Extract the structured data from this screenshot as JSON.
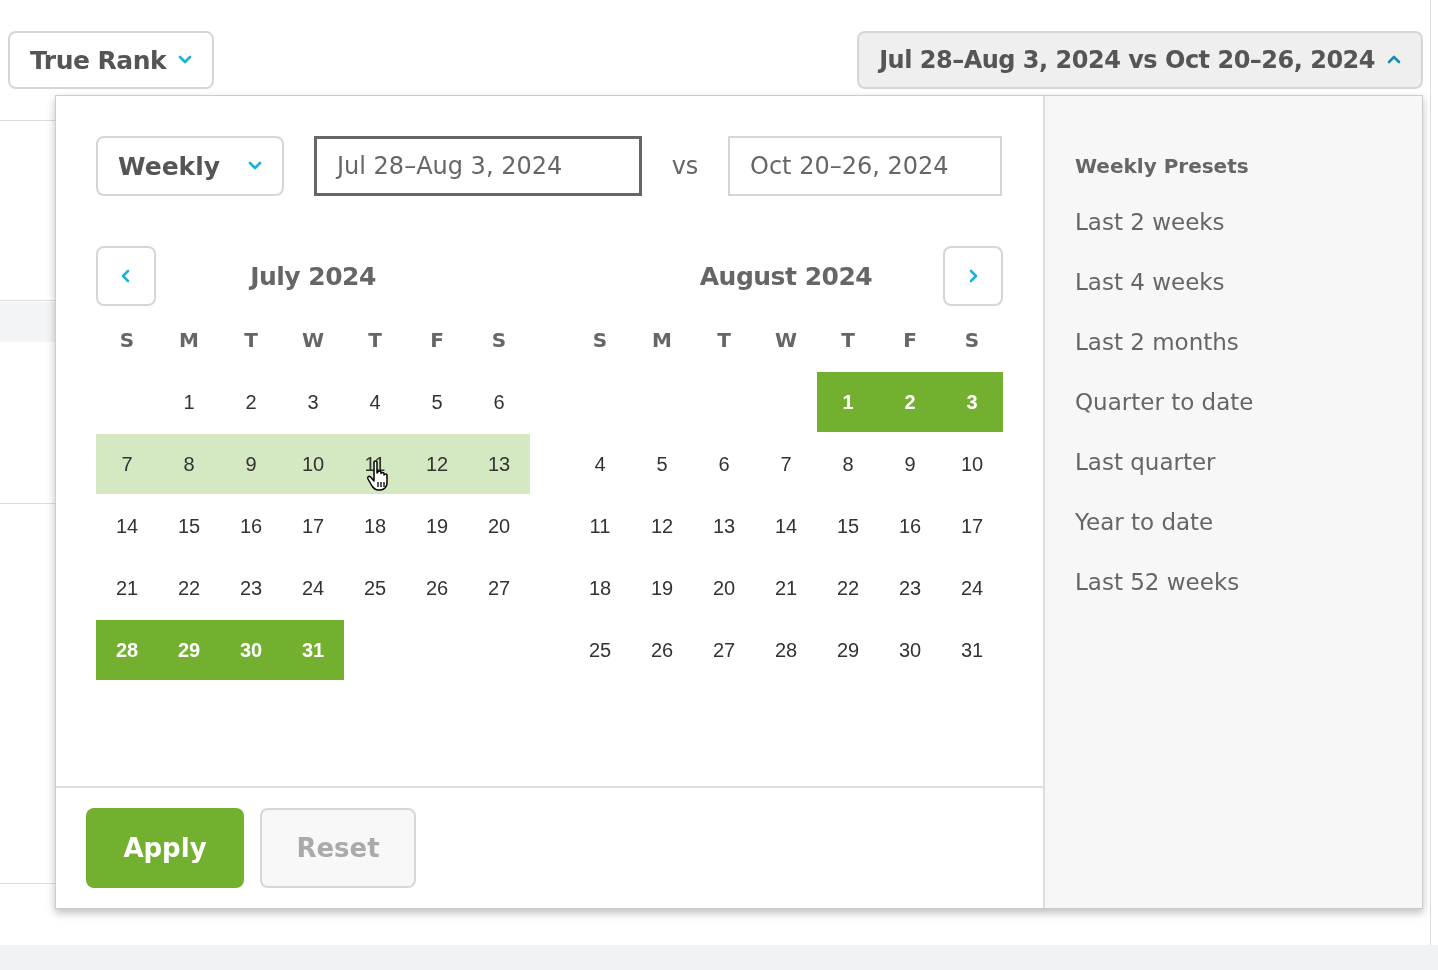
{
  "metric_button": {
    "label": "True Rank"
  },
  "range_button": {
    "label": "Jul 28–Aug 3, 2024 vs Oct 20–26, 2024",
    "expanded": true
  },
  "picker": {
    "period_select": {
      "label": "Weekly"
    },
    "primary_range": {
      "value": "Jul 28–Aug 3, 2024",
      "focused": true
    },
    "vs_label": "vs",
    "compare_range": {
      "value": "Oct 20–26, 2024",
      "focused": false
    },
    "months": [
      {
        "title": "July 2024",
        "weekdays": [
          "S",
          "M",
          "T",
          "W",
          "T",
          "F",
          "S"
        ],
        "weeks": [
          {
            "hovered": false,
            "days": [
              {
                "kind": "blank"
              },
              {
                "kind": "day",
                "label": "1",
                "selected": false
              },
              {
                "kind": "day",
                "label": "2",
                "selected": false
              },
              {
                "kind": "day",
                "label": "3",
                "selected": false
              },
              {
                "kind": "day",
                "label": "4",
                "selected": false
              },
              {
                "kind": "day",
                "label": "5",
                "selected": false
              },
              {
                "kind": "day",
                "label": "6",
                "selected": false
              }
            ]
          },
          {
            "hovered": true,
            "days": [
              {
                "kind": "day",
                "label": "7",
                "selected": false
              },
              {
                "kind": "day",
                "label": "8",
                "selected": false
              },
              {
                "kind": "day",
                "label": "9",
                "selected": false
              },
              {
                "kind": "day",
                "label": "10",
                "selected": false
              },
              {
                "kind": "day",
                "label": "11",
                "selected": false,
                "pointer": true
              },
              {
                "kind": "day",
                "label": "12",
                "selected": false
              },
              {
                "kind": "day",
                "label": "13",
                "selected": false
              }
            ]
          },
          {
            "hovered": false,
            "days": [
              {
                "kind": "day",
                "label": "14",
                "selected": false
              },
              {
                "kind": "day",
                "label": "15",
                "selected": false
              },
              {
                "kind": "day",
                "label": "16",
                "selected": false
              },
              {
                "kind": "day",
                "label": "17",
                "selected": false
              },
              {
                "kind": "day",
                "label": "18",
                "selected": false
              },
              {
                "kind": "day",
                "label": "19",
                "selected": false
              },
              {
                "kind": "day",
                "label": "20",
                "selected": false
              }
            ]
          },
          {
            "hovered": false,
            "days": [
              {
                "kind": "day",
                "label": "21",
                "selected": false
              },
              {
                "kind": "day",
                "label": "22",
                "selected": false
              },
              {
                "kind": "day",
                "label": "23",
                "selected": false
              },
              {
                "kind": "day",
                "label": "24",
                "selected": false
              },
              {
                "kind": "day",
                "label": "25",
                "selected": false
              },
              {
                "kind": "day",
                "label": "26",
                "selected": false
              },
              {
                "kind": "day",
                "label": "27",
                "selected": false
              }
            ]
          },
          {
            "hovered": false,
            "days": [
              {
                "kind": "day",
                "label": "28",
                "selected": true
              },
              {
                "kind": "day",
                "label": "29",
                "selected": true
              },
              {
                "kind": "day",
                "label": "30",
                "selected": true
              },
              {
                "kind": "day",
                "label": "31",
                "selected": true
              }
            ]
          }
        ]
      },
      {
        "title": "August 2024",
        "weekdays": [
          "S",
          "M",
          "T",
          "W",
          "T",
          "F",
          "S"
        ],
        "weeks": [
          {
            "hovered": false,
            "days": [
              {
                "kind": "blank"
              },
              {
                "kind": "blank"
              },
              {
                "kind": "blank"
              },
              {
                "kind": "blank"
              },
              {
                "kind": "day",
                "label": "1",
                "selected": true
              },
              {
                "kind": "day",
                "label": "2",
                "selected": true
              },
              {
                "kind": "day",
                "label": "3",
                "selected": true
              }
            ]
          },
          {
            "hovered": false,
            "days": [
              {
                "kind": "day",
                "label": "4",
                "selected": false
              },
              {
                "kind": "day",
                "label": "5",
                "selected": false
              },
              {
                "kind": "day",
                "label": "6",
                "selected": false
              },
              {
                "kind": "day",
                "label": "7",
                "selected": false
              },
              {
                "kind": "day",
                "label": "8",
                "selected": false
              },
              {
                "kind": "day",
                "label": "9",
                "selected": false
              },
              {
                "kind": "day",
                "label": "10",
                "selected": false
              }
            ]
          },
          {
            "hovered": false,
            "days": [
              {
                "kind": "day",
                "label": "11",
                "selected": false
              },
              {
                "kind": "day",
                "label": "12",
                "selected": false
              },
              {
                "kind": "day",
                "label": "13",
                "selected": false
              },
              {
                "kind": "day",
                "label": "14",
                "selected": false
              },
              {
                "kind": "day",
                "label": "15",
                "selected": false
              },
              {
                "kind": "day",
                "label": "16",
                "selected": false
              },
              {
                "kind": "day",
                "label": "17",
                "selected": false
              }
            ]
          },
          {
            "hovered": false,
            "days": [
              {
                "kind": "day",
                "label": "18",
                "selected": false
              },
              {
                "kind": "day",
                "label": "19",
                "selected": false
              },
              {
                "kind": "day",
                "label": "20",
                "selected": false
              },
              {
                "kind": "day",
                "label": "21",
                "selected": false
              },
              {
                "kind": "day",
                "label": "22",
                "selected": false
              },
              {
                "kind": "day",
                "label": "23",
                "selected": false
              },
              {
                "kind": "day",
                "label": "24",
                "selected": false
              }
            ]
          },
          {
            "hovered": false,
            "days": [
              {
                "kind": "day",
                "label": "25",
                "selected": false
              },
              {
                "kind": "day",
                "label": "26",
                "selected": false
              },
              {
                "kind": "day",
                "label": "27",
                "selected": false
              },
              {
                "kind": "day",
                "label": "28",
                "selected": false
              },
              {
                "kind": "day",
                "label": "29",
                "selected": false
              },
              {
                "kind": "day",
                "label": "30",
                "selected": false
              },
              {
                "kind": "day",
                "label": "31",
                "selected": false
              }
            ]
          }
        ]
      }
    ],
    "apply_button": {
      "label": "Apply",
      "disabled": false
    },
    "reset_button": {
      "label": "Reset",
      "disabled": true
    },
    "presets": {
      "heading": "Weekly Presets",
      "items": [
        "Last 2 weeks",
        "Last 4 weeks",
        "Last 2 months",
        "Quarter to date",
        "Last quarter",
        "Year to date",
        "Last 52 weeks"
      ]
    }
  }
}
